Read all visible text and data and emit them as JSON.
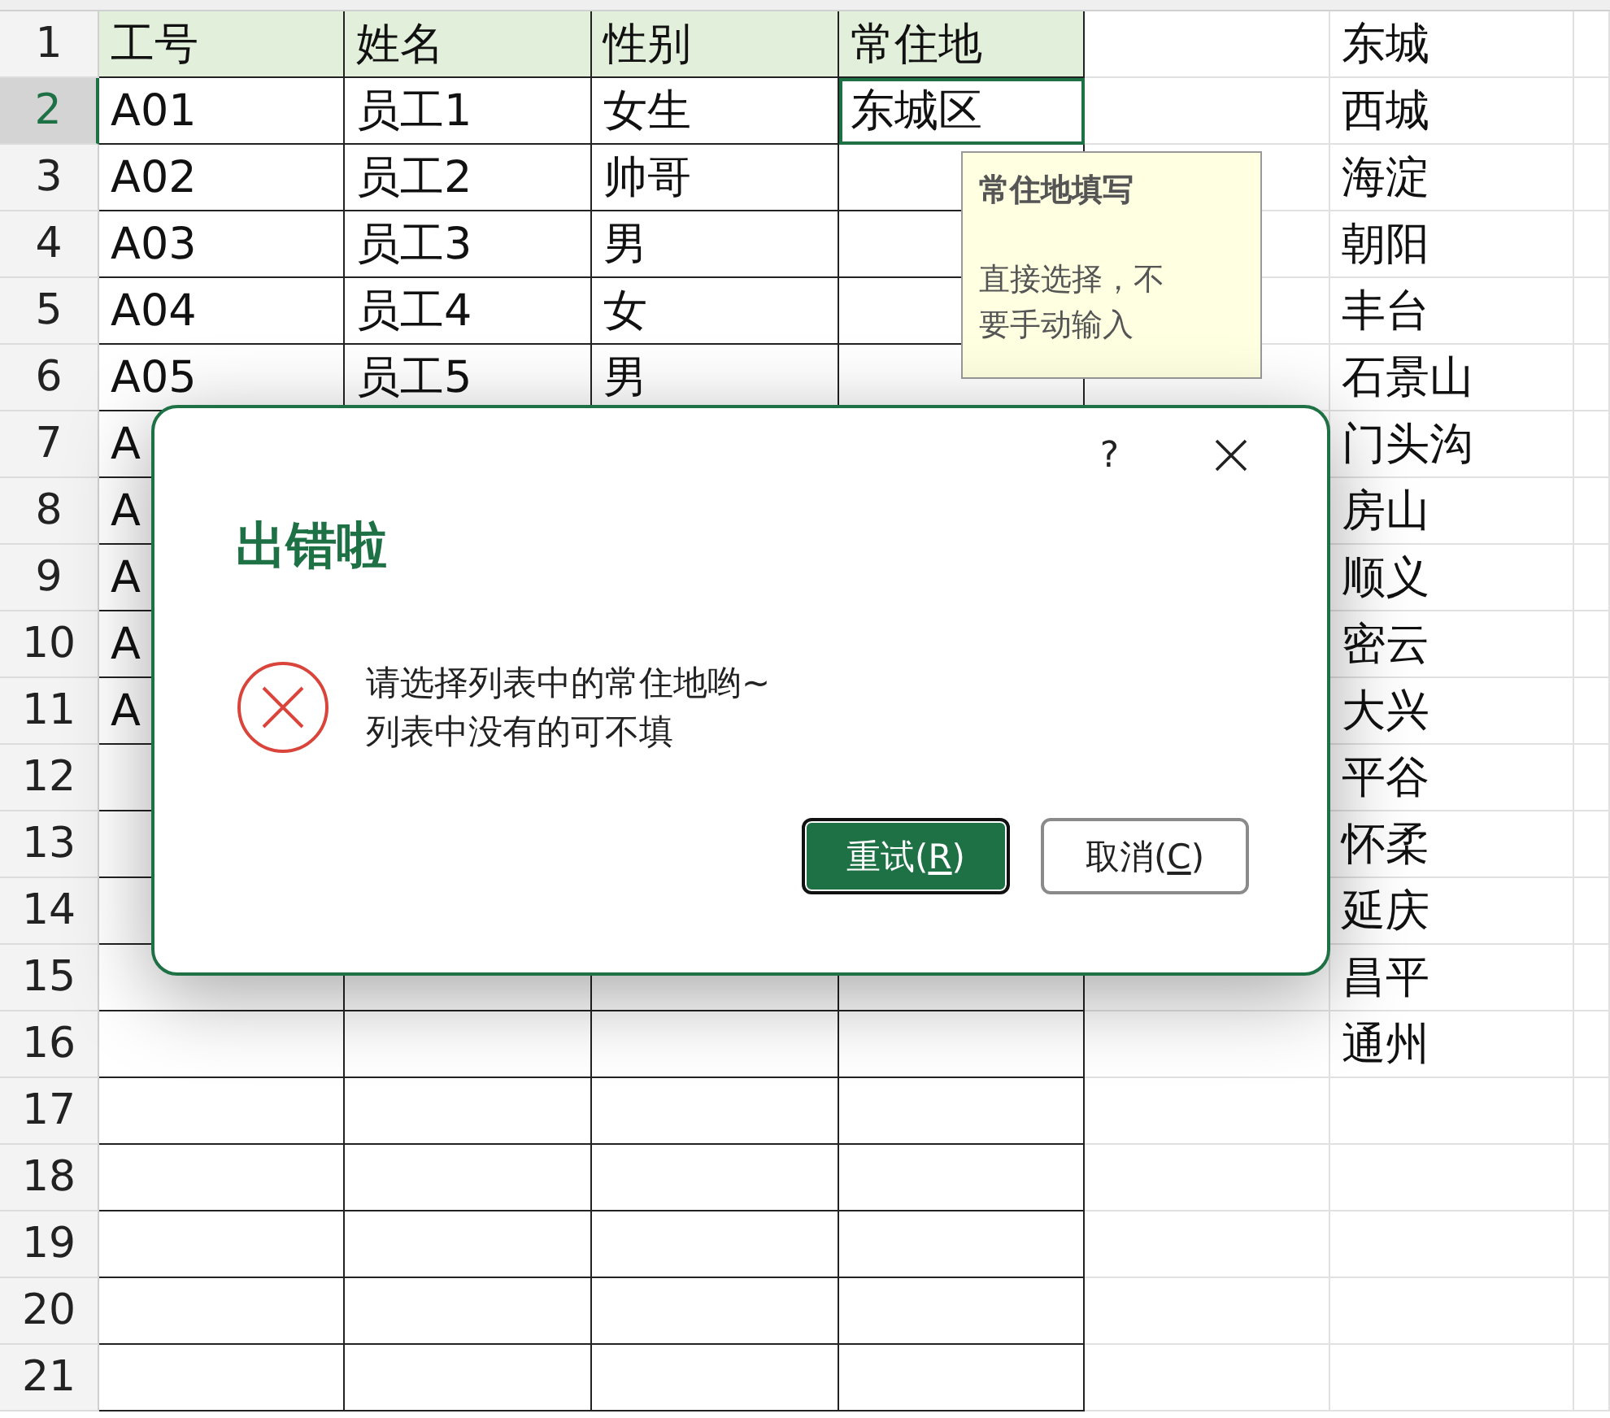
{
  "sheet": {
    "rows": [
      {
        "number": "1",
        "selected": false,
        "kind": "header",
        "cells": [
          {
            "text": "工号",
            "selected": false
          },
          {
            "text": "姓名",
            "selected": false
          },
          {
            "text": "性别",
            "selected": false
          },
          {
            "text": "常住地",
            "selected": false
          }
        ],
        "list_item": "东城"
      },
      {
        "number": "2",
        "selected": true,
        "kind": "data",
        "cells": [
          {
            "text": "A01",
            "selected": false
          },
          {
            "text": "员工1",
            "selected": false
          },
          {
            "text": "女生",
            "selected": false
          },
          {
            "text": "东城区",
            "selected": true
          }
        ],
        "list_item": "西城"
      },
      {
        "number": "3",
        "selected": false,
        "kind": "data",
        "cells": [
          {
            "text": "A02",
            "selected": false
          },
          {
            "text": "员工2",
            "selected": false
          },
          {
            "text": "帅哥",
            "selected": false
          },
          {
            "selected": false
          }
        ],
        "list_item": "海淀"
      },
      {
        "number": "4",
        "selected": false,
        "kind": "data",
        "cells": [
          {
            "text": "A03",
            "selected": false
          },
          {
            "text": "员工3",
            "selected": false
          },
          {
            "text": "男",
            "selected": false
          },
          {
            "selected": false
          }
        ],
        "list_item": "朝阳"
      },
      {
        "number": "5",
        "selected": false,
        "kind": "data",
        "cells": [
          {
            "text": "A04",
            "selected": false
          },
          {
            "text": "员工4",
            "selected": false
          },
          {
            "text": "女",
            "selected": false
          },
          {
            "selected": false
          }
        ],
        "list_item": "丰台"
      },
      {
        "number": "6",
        "selected": false,
        "kind": "data",
        "cells": [
          {
            "text": "A05",
            "selected": false
          },
          {
            "text": "员工5",
            "selected": false
          },
          {
            "text": "男",
            "selected": false
          },
          {
            "selected": false
          }
        ],
        "list_item": "石景山"
      },
      {
        "number": "7",
        "selected": false,
        "kind": "data",
        "cells": [
          {
            "text": "A",
            "selected": false
          }
        ],
        "list_item": "门头沟"
      },
      {
        "number": "8",
        "selected": false,
        "kind": "data",
        "cells": [
          {
            "text": "A",
            "selected": false
          }
        ],
        "list_item": "房山"
      },
      {
        "number": "9",
        "selected": false,
        "kind": "data",
        "cells": [
          {
            "text": "A",
            "selected": false
          }
        ],
        "list_item": "顺义"
      },
      {
        "number": "10",
        "selected": false,
        "kind": "data",
        "cells": [
          {
            "text": "A",
            "selected": false
          }
        ],
        "list_item": "密云"
      },
      {
        "number": "11",
        "selected": false,
        "kind": "data",
        "cells": [
          {
            "text": "A",
            "selected": false
          }
        ],
        "list_item": "大兴"
      },
      {
        "number": "12",
        "selected": false,
        "kind": "data",
        "cells": [
          {
            "selected": false
          }
        ],
        "list_item": "平谷"
      },
      {
        "number": "13",
        "selected": false,
        "kind": "data",
        "cells": [
          {
            "selected": false
          }
        ],
        "list_item": "怀柔"
      },
      {
        "number": "14",
        "selected": false,
        "kind": "data",
        "cells": [
          {
            "selected": false
          }
        ],
        "list_item": "延庆"
      },
      {
        "number": "15",
        "selected": false,
        "kind": "data",
        "cells": [
          {
            "selected": false
          },
          {
            "selected": false
          },
          {
            "selected": false
          },
          {
            "selected": false
          }
        ],
        "list_item": "昌平"
      },
      {
        "number": "16",
        "selected": false,
        "kind": "data",
        "cells": [
          {
            "selected": false
          },
          {
            "selected": false
          },
          {
            "selected": false
          },
          {
            "selected": false
          }
        ],
        "list_item": "通州"
      },
      {
        "number": "17",
        "selected": false,
        "kind": "data",
        "cells": [
          {
            "selected": false
          },
          {
            "selected": false
          },
          {
            "selected": false
          },
          {
            "selected": false
          }
        ]
      },
      {
        "number": "18",
        "selected": false,
        "kind": "data",
        "cells": [
          {
            "selected": false
          },
          {
            "selected": false
          },
          {
            "selected": false
          },
          {
            "selected": false
          }
        ]
      },
      {
        "number": "19",
        "selected": false,
        "kind": "data",
        "cells": [
          {
            "selected": false
          },
          {
            "selected": false
          },
          {
            "selected": false
          },
          {
            "selected": false
          }
        ]
      },
      {
        "number": "20",
        "selected": false,
        "kind": "data",
        "cells": [
          {
            "selected": false
          },
          {
            "selected": false
          },
          {
            "selected": false
          },
          {
            "selected": false
          }
        ]
      },
      {
        "number": "21",
        "selected": false,
        "kind": "data",
        "cells": [
          {
            "selected": false
          },
          {
            "selected": false
          },
          {
            "selected": false
          },
          {
            "selected": false
          }
        ]
      }
    ]
  },
  "tooltip": {
    "title": "常住地填写",
    "body": "直接选择，不要手动输入"
  },
  "dialog": {
    "help": "?",
    "title": "出错啦",
    "message_lines": [
      "请选择列表中的常住地哟~",
      "列表中没有的可不填"
    ],
    "buttons": [
      {
        "before": "重试(",
        "key": "R",
        "after": ")",
        "selected": true
      },
      {
        "before": "取消(",
        "key": "C",
        "after": ")",
        "selected": false
      }
    ]
  }
}
